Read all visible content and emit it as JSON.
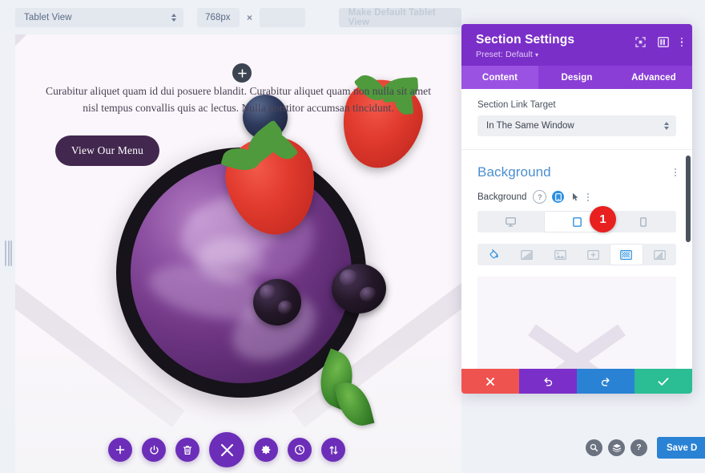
{
  "toolbar": {
    "view_mode": "Tablet View",
    "width_value": "768px",
    "separator": "×",
    "height_value": "",
    "height_placeholder": "",
    "make_default_label": "Make Default Tablet View"
  },
  "canvas": {
    "hero_text": "Curabitur aliquet quam id dui posuere blandit. Curabitur aliquet quam non nulla sit amet nisl tempus convallis quis ac lectus. Nulla porttitor accumsan tincidunt.",
    "hero_button": "View Our Menu",
    "add_section_icon": "plus-icon",
    "resize_handle_icon": "drag-handle-icon"
  },
  "section_toolbar": {
    "items": [
      {
        "name": "add-section-button",
        "icon": "plus-icon"
      },
      {
        "name": "disable-section-button",
        "icon": "power-icon"
      },
      {
        "name": "delete-section-button",
        "icon": "trash-icon"
      },
      {
        "name": "close-section-button",
        "icon": "close-icon"
      },
      {
        "name": "section-settings-button",
        "icon": "gear-icon"
      },
      {
        "name": "section-history-button",
        "icon": "clock-icon"
      },
      {
        "name": "section-reorder-button",
        "icon": "sort-arrows-icon"
      }
    ]
  },
  "panel": {
    "title": "Section Settings",
    "preset_label": "Preset: Default",
    "preset_caret": "▾",
    "header_icons": [
      {
        "name": "expand-panel-icon",
        "icon": "fullscreen-icon"
      },
      {
        "name": "dock-panel-icon",
        "icon": "layout-columns-icon"
      },
      {
        "name": "panel-menu-icon",
        "icon": "vertical-dots-icon"
      }
    ],
    "tabs": [
      {
        "label": "Content",
        "active": true
      },
      {
        "label": "Design",
        "active": false
      },
      {
        "label": "Advanced",
        "active": false
      }
    ],
    "link_target": {
      "label": "Section Link Target",
      "value": "In The Same Window"
    },
    "background": {
      "section_title": "Background",
      "row_label": "Background",
      "help_icon": "?",
      "responsive_icon": "responsive-toggle-icon",
      "hover_icon": "hover-cursor-icon",
      "options_icon": "vertical-dots-icon",
      "badge": "1",
      "devices": [
        {
          "name": "desktop",
          "icon": "desktop-icon",
          "active": false
        },
        {
          "name": "tablet",
          "icon": "tablet-icon",
          "active": true
        },
        {
          "name": "phone",
          "icon": "phone-icon",
          "active": false
        }
      ],
      "types": [
        {
          "name": "background-color",
          "icon": "paint-bucket-icon",
          "state": "blue"
        },
        {
          "name": "background-gradient",
          "icon": "gradient-icon",
          "state": "off"
        },
        {
          "name": "background-image",
          "icon": "image-icon",
          "state": "off"
        },
        {
          "name": "background-video",
          "icon": "video-icon",
          "state": "off"
        },
        {
          "name": "background-pattern",
          "icon": "pattern-icon",
          "state": "selected"
        },
        {
          "name": "background-mask",
          "icon": "mask-icon",
          "state": "off"
        }
      ]
    },
    "actions": [
      {
        "name": "discard-changes-button",
        "icon": "close-icon",
        "color": "#ef5350"
      },
      {
        "name": "undo-button",
        "icon": "undo-icon",
        "color": "#7b2fc9"
      },
      {
        "name": "redo-button",
        "icon": "redo-icon",
        "color": "#2a82d4"
      },
      {
        "name": "save-changes-button",
        "icon": "check-icon",
        "color": "#2bbd93"
      }
    ]
  },
  "bottom_bar": {
    "buttons": [
      {
        "name": "search-button",
        "icon": "search-icon"
      },
      {
        "name": "layers-button",
        "icon": "layers-icon"
      },
      {
        "name": "help-button",
        "icon": "question-icon"
      }
    ],
    "save_label": "Save D"
  },
  "colors": {
    "panel_header": "#7b2fc9",
    "panel_tabs": "#8a3ed6",
    "tab_active": "#9a52e3",
    "accent_blue": "#2d8fe0",
    "section_title_blue": "#4a8ed0",
    "badge_red": "#e8201f",
    "action_close": "#ef5350",
    "action_undo": "#7b2fc9",
    "action_redo": "#2a82d4",
    "action_save": "#2bbd93",
    "fab_purple": "#6c2eb9",
    "hero_button": "#42274f",
    "app_background": "#eef1f6"
  }
}
